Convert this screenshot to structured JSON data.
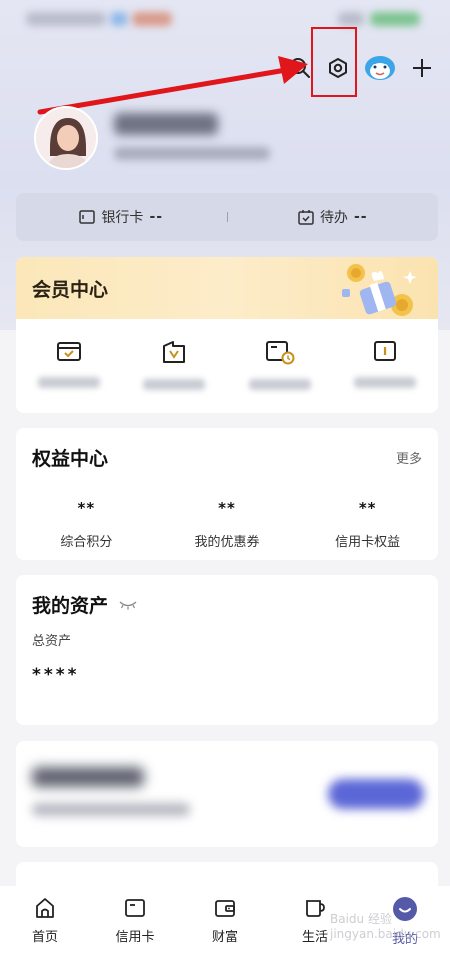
{
  "summary": {
    "bank_card_label": "银行卡",
    "bank_card_value": "--",
    "todo_label": "待办",
    "todo_value": "--"
  },
  "member": {
    "title": "会员中心"
  },
  "rights": {
    "title": "权益中心",
    "more": "更多",
    "items": [
      {
        "value": "**",
        "label": "综合积分"
      },
      {
        "value": "**",
        "label": "我的优惠券"
      },
      {
        "value": "**",
        "label": "信用卡权益"
      }
    ]
  },
  "assets": {
    "title": "我的资产",
    "total_label": "总资产",
    "total_value": "****"
  },
  "tabbar": {
    "tabs": [
      {
        "label": "首页",
        "icon": "home-icon"
      },
      {
        "label": "信用卡",
        "icon": "credit-card-icon"
      },
      {
        "label": "财富",
        "icon": "wallet-icon"
      },
      {
        "label": "生活",
        "icon": "cup-icon"
      },
      {
        "label": "我的",
        "icon": "profile-icon"
      }
    ],
    "active_index": 4
  },
  "watermark": "Baidu 经验 jingyan.baidu.com",
  "colors": {
    "accent": "#555aa8",
    "highlight": "#e0161b",
    "member_gold": "#fbe7b9",
    "icon_gold": "#c8901c"
  }
}
